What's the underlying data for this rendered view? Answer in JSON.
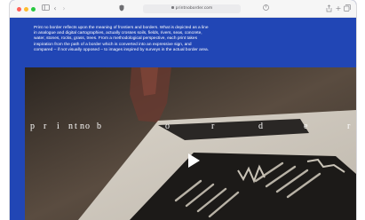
{
  "browser": {
    "url": "printnoborder.com",
    "icons": {
      "sidebar": "sidebar-icon",
      "back": "chevron-left-icon",
      "forward": "chevron-right-icon",
      "privacy": "shield-icon",
      "reader": "reader-icon",
      "share": "share-icon",
      "new_tab": "plus-icon",
      "tabs": "tabs-icon"
    }
  },
  "intro": {
    "text": "Print no border reflects upon the meaning of frontiers and borders. What is depicted as a line in analogue and digital cartographies, actually crosses soils, fields, rivers, seas, concrete, water, stones, rocks, grass, trees. From a methodological perspective, each print takes inspiration from the path of a border which is converted into an expressive sign, and compared – if not visually opposed – to images inspired by surveys in the actual border area."
  },
  "video": {
    "title_letters": [
      "p",
      "r",
      "i",
      "n",
      "t",
      "n",
      "o",
      "b",
      "o",
      "r",
      "d",
      "e",
      "r"
    ]
  },
  "colors": {
    "background": "#2146b5",
    "text": "#ffffff"
  }
}
